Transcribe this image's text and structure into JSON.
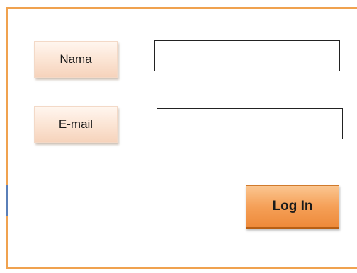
{
  "form": {
    "name_label": "Nama",
    "email_label": "E-mail",
    "name_value": "",
    "email_value": "",
    "login_label": "Log In"
  },
  "colors": {
    "frame_border": "#f0a24f",
    "label_bg": "#fbe3d2",
    "login_bg": "#f5a058"
  }
}
